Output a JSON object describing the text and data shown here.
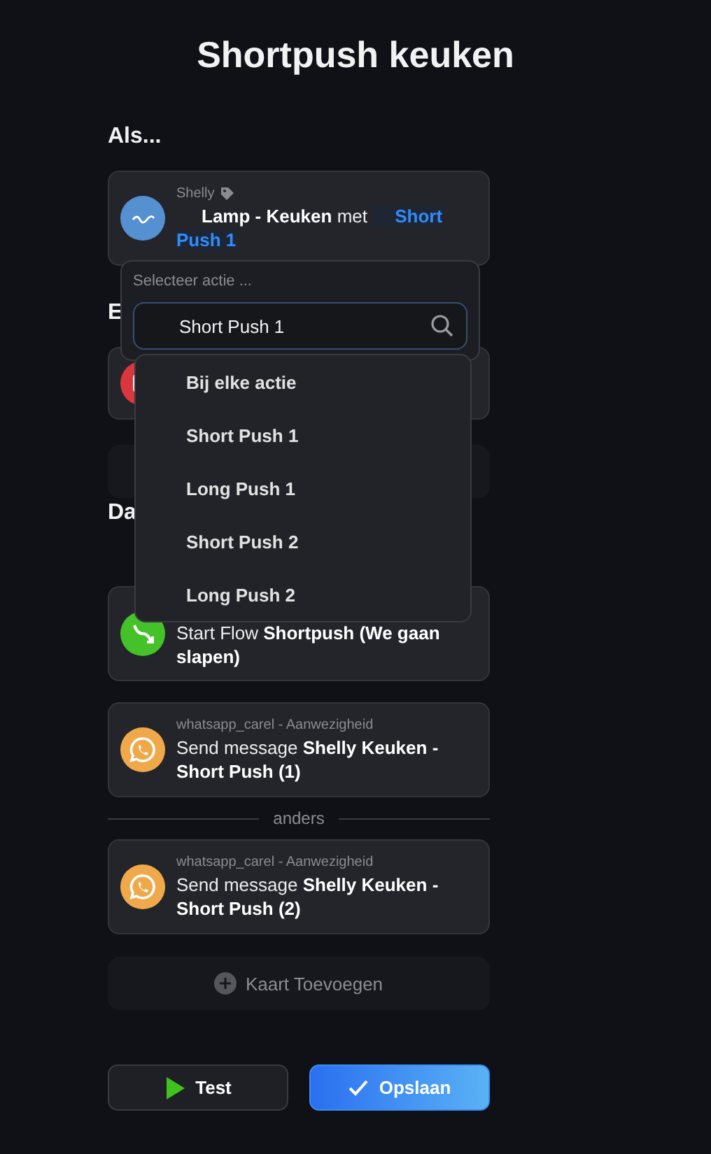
{
  "title": "Shortpush keuken",
  "trigger": {
    "heading": "Als...",
    "card": {
      "app": "Shelly",
      "kind": "logo",
      "color": "#5590d0",
      "parts": [
        {
          "kind": "token",
          "text": "Lamp - Keuken"
        },
        {
          "kind": "plain",
          "text": "met"
        },
        {
          "kind": "arg",
          "text": "Short Push 1"
        }
      ]
    }
  },
  "conditions": {
    "heading": "E",
    "cards": [
      {
        "kind": "app",
        "color": "#d9363e"
      }
    ]
  },
  "actions": {
    "heading": "Da",
    "cards": [
      {
        "kind": "flow",
        "color": "#45c12a",
        "text": "Start Flow **Shortpush (We gaan slapen)**"
      },
      {
        "kind": "chat",
        "color": "#f0a94a",
        "app": "whatsapp_carel - Aanwezigheid",
        "text": "Send message **Shelly Keuken - Short Push (1)**"
      }
    ],
    "divider": "anders",
    "else_cards": [
      {
        "kind": "chat",
        "color": "#f0a94a",
        "app": "whatsapp_carel - Aanwezigheid",
        "text": "Send message **Shelly Keuken - Short Push (2)**"
      }
    ],
    "add_label": "Kaart Toevoegen"
  },
  "buttons": [
    {
      "kind": "test",
      "label": "Test"
    },
    {
      "kind": "save",
      "label": "Opslaan"
    }
  ],
  "popup": {
    "label": "Selecteer actie ...",
    "search_value": "Short Push 1",
    "options": [
      {
        "label": "Bij elke actie",
        "selected": false
      },
      {
        "label": "Short Push 1",
        "selected": false
      },
      {
        "label": "Long Push 1",
        "selected": false
      },
      {
        "label": "Short Push 2",
        "selected": false
      },
      {
        "label": "Long Push 2",
        "selected": false
      }
    ]
  }
}
